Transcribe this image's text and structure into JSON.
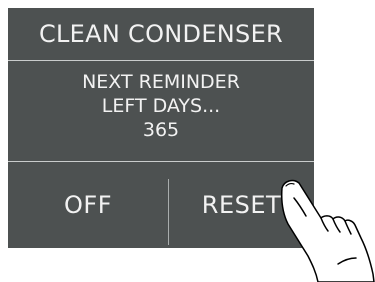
{
  "panel": {
    "title": "CLEAN CONDENSER",
    "message": {
      "line1": "NEXT REMINDER",
      "line2": "LEFT DAYS...",
      "days": "365"
    },
    "buttons": {
      "off_label": "OFF",
      "reset_label": "RESET"
    }
  },
  "colors": {
    "panel_background": "#4d5151",
    "text": "#f2f2f2",
    "divider": "#c9cccc"
  },
  "icons": {
    "hand": "pointing-hand-icon"
  }
}
